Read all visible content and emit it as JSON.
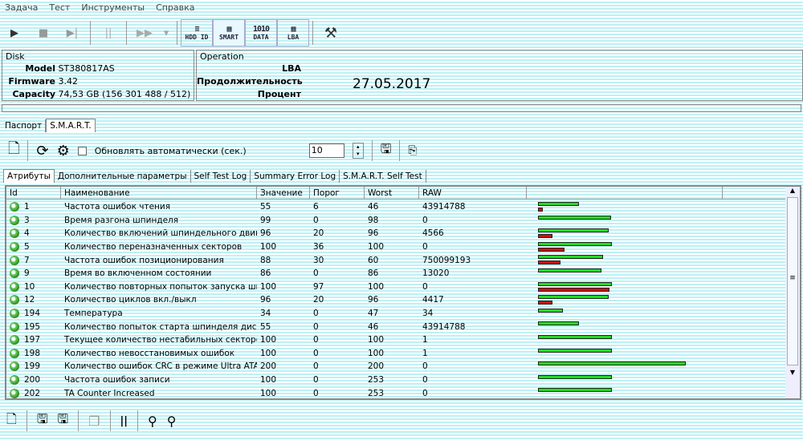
{
  "menu": [
    "Задача",
    "Тест",
    "Инструменты",
    "Справка"
  ],
  "toolbar": {
    "play": "▶",
    "stop": "■",
    "skip": "▶|",
    "pause": "||",
    "forward": "▶▶",
    "dropdown": "▾",
    "hdd_id": "HDD ID",
    "smart": "SMART",
    "data": "DATA",
    "lba": "LBA",
    "tools": "⚒"
  },
  "disk": {
    "title": "Disk",
    "model_label": "Model",
    "model": "ST380817AS",
    "firmware_label": "Firmware",
    "firmware": "3.42",
    "capacity_label": "Capacity",
    "capacity": "74,53 GB (156 301 488 / 512)"
  },
  "operation": {
    "title": "Operation",
    "lba": "LBA",
    "duration": "Продолжительность",
    "percent": "Процент",
    "date": "27.05.2017"
  },
  "main_tabs": [
    "Паспорт",
    "S.M.A.R.T."
  ],
  "smart_toolbar": {
    "auto_update_label": "Обновлять автоматически (сек.)",
    "auto_update_checked": false,
    "interval": "10"
  },
  "sub_tabs": [
    "Атрибуты",
    "Дополнительные параметры",
    "Self Test Log",
    "Summary Error Log",
    "S.M.A.R.T. Self Test"
  ],
  "columns": [
    "Id",
    "Наименование",
    "Значение",
    "Порог",
    "Worst",
    "RAW"
  ],
  "colors": {
    "value_bar": "#22dd22",
    "threshold_bar": "#cc1111"
  },
  "rows": [
    {
      "id": "1",
      "name": "Частота ошибок чтения",
      "value": "55",
      "threshold": "6",
      "worst": "46",
      "raw": "43914788"
    },
    {
      "id": "3",
      "name": "Время разгона шпинделя",
      "value": "99",
      "threshold": "0",
      "worst": "98",
      "raw": "0"
    },
    {
      "id": "4",
      "name": "Количество включений шпиндельного двигател",
      "value": "96",
      "threshold": "20",
      "worst": "96",
      "raw": "4566"
    },
    {
      "id": "5",
      "name": "Количество переназначенных секторов",
      "value": "100",
      "threshold": "36",
      "worst": "100",
      "raw": "0"
    },
    {
      "id": "7",
      "name": "Частота ошибок позиционирования",
      "value": "88",
      "threshold": "30",
      "worst": "60",
      "raw": "750099193"
    },
    {
      "id": "9",
      "name": "Время во включенном состоянии",
      "value": "86",
      "threshold": "0",
      "worst": "86",
      "raw": "13020"
    },
    {
      "id": "10",
      "name": "Количество повторных попыток запуска шпинде",
      "value": "100",
      "threshold": "97",
      "worst": "100",
      "raw": "0"
    },
    {
      "id": "12",
      "name": "Количество циклов вкл./выкл",
      "value": "96",
      "threshold": "20",
      "worst": "96",
      "raw": "4417"
    },
    {
      "id": "194",
      "name": "Температура",
      "value": "34",
      "threshold": "0",
      "worst": "47",
      "raw": "34"
    },
    {
      "id": "195",
      "name": "Количество попыток старта шпинделя диска",
      "value": "55",
      "threshold": "0",
      "worst": "46",
      "raw": "43914788"
    },
    {
      "id": "197",
      "name": "Текущее количество нестабильных секторов.",
      "value": "100",
      "threshold": "0",
      "worst": "100",
      "raw": "1"
    },
    {
      "id": "198",
      "name": "Количество невосстановимых ошибок",
      "value": "100",
      "threshold": "0",
      "worst": "100",
      "raw": "1"
    },
    {
      "id": "199",
      "name": "Количество ошибок CRC в режиме Ultra ATA",
      "value": "200",
      "threshold": "0",
      "worst": "200",
      "raw": "0"
    },
    {
      "id": "200",
      "name": "Частота ошибок записи",
      "value": "100",
      "threshold": "0",
      "worst": "253",
      "raw": "0"
    },
    {
      "id": "202",
      "name": "TA Counter Increased",
      "value": "100",
      "threshold": "0",
      "worst": "253",
      "raw": "0"
    }
  ]
}
